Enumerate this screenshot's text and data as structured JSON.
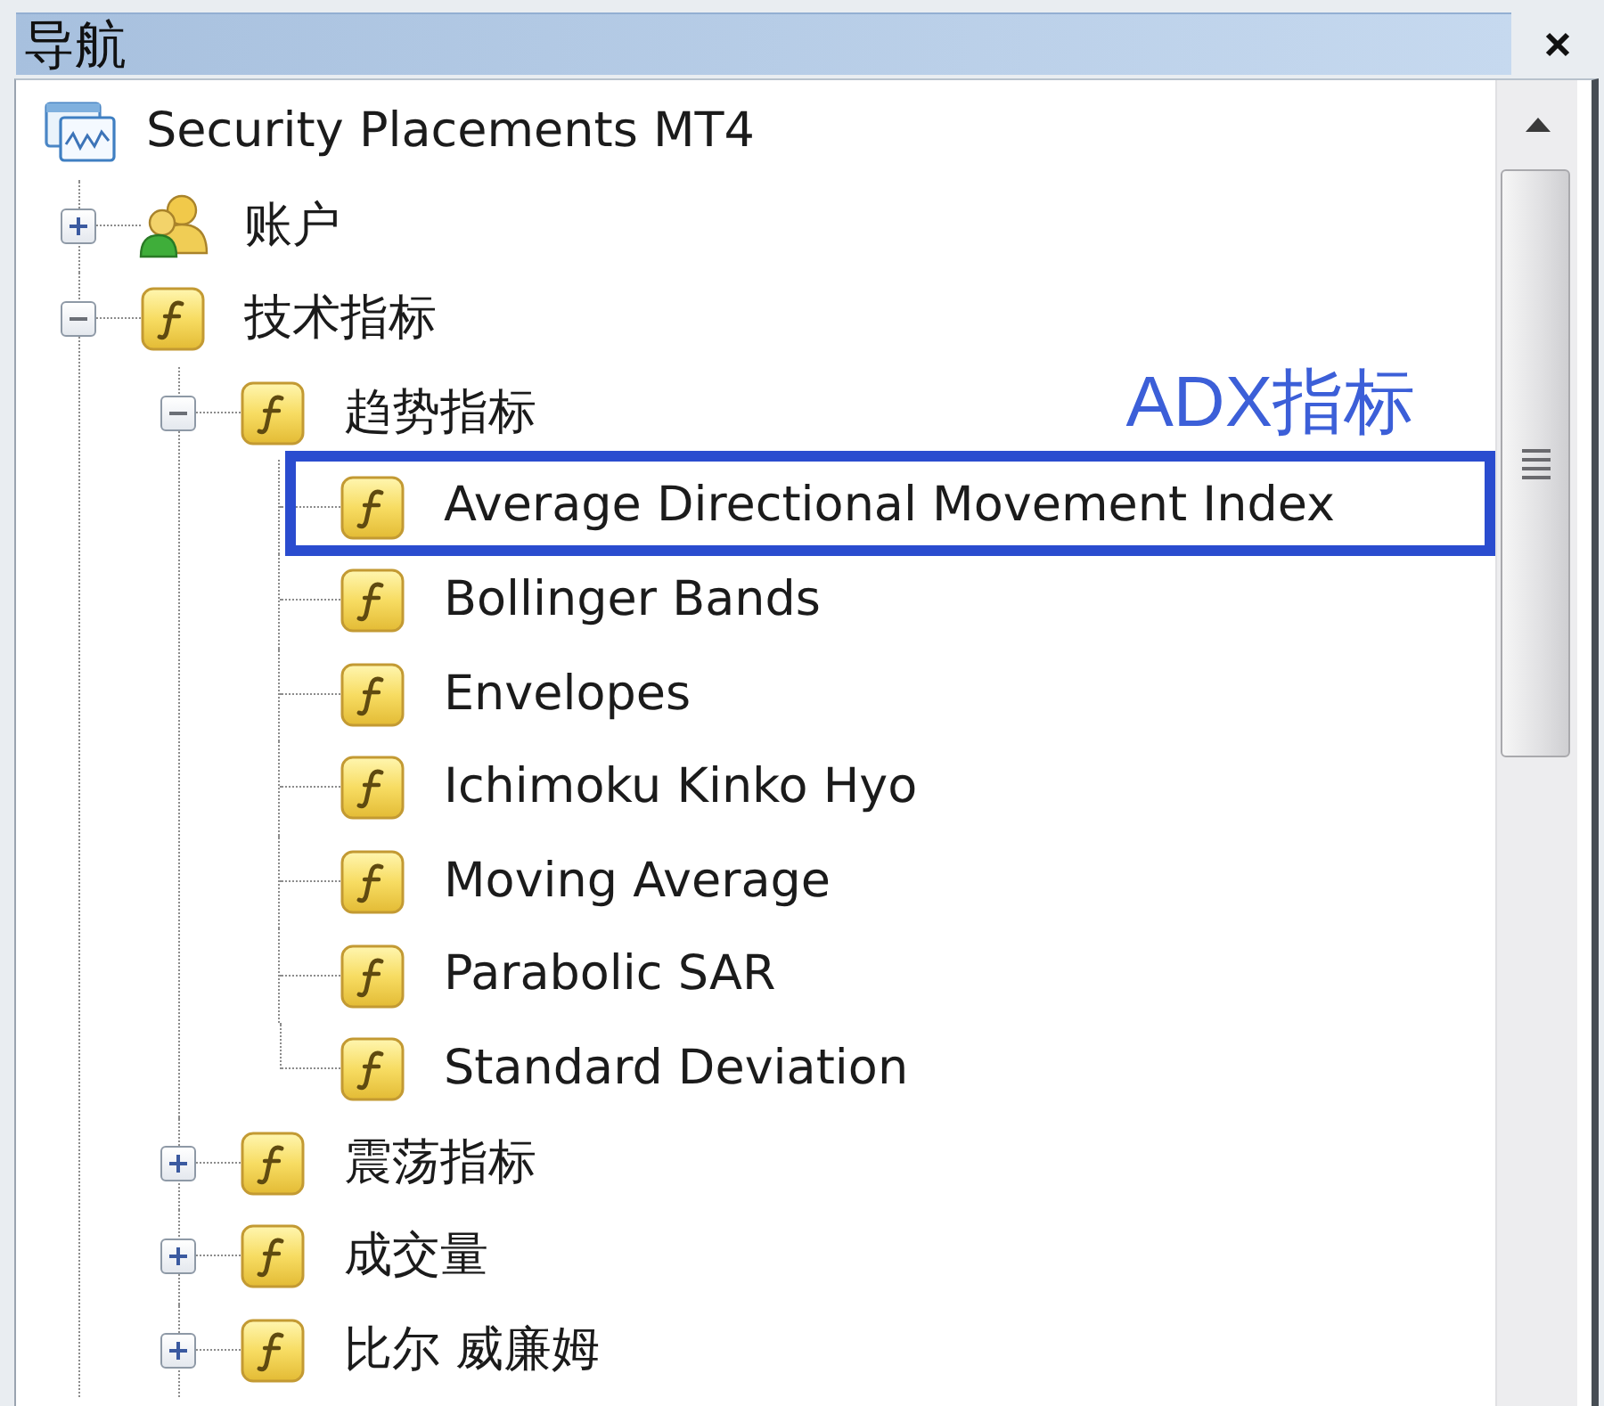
{
  "panel": {
    "title": "导航"
  },
  "tree": {
    "label": "Security Placements MT4",
    "kind": "terminal",
    "highlighted": false,
    "children": [
      {
        "label": "账户",
        "kind": "accounts",
        "expanded": false,
        "highlighted": false
      },
      {
        "label": "技术指标",
        "kind": "function",
        "expanded": true,
        "highlighted": false,
        "children": [
          {
            "label": "趋势指标",
            "kind": "function",
            "expanded": true,
            "highlighted": false,
            "children": [
              {
                "label": "Average Directional Movement Index",
                "kind": "function",
                "highlighted": true
              },
              {
                "label": "Bollinger Bands",
                "kind": "function",
                "highlighted": false
              },
              {
                "label": "Envelopes",
                "kind": "function",
                "highlighted": false
              },
              {
                "label": "Ichimoku Kinko Hyo",
                "kind": "function",
                "highlighted": false
              },
              {
                "label": "Moving Average",
                "kind": "function",
                "highlighted": false
              },
              {
                "label": "Parabolic SAR",
                "kind": "function",
                "highlighted": false
              },
              {
                "label": "Standard Deviation",
                "kind": "function",
                "highlighted": false
              }
            ]
          },
          {
            "label": "震荡指标",
            "kind": "function",
            "expanded": false,
            "highlighted": false
          },
          {
            "label": "成交量",
            "kind": "function",
            "expanded": false,
            "highlighted": false
          },
          {
            "label": "比尔 威廉姆",
            "kind": "function",
            "expanded": false,
            "highlighted": false
          }
        ]
      }
    ]
  },
  "annotation": {
    "text": "ADX指标"
  }
}
